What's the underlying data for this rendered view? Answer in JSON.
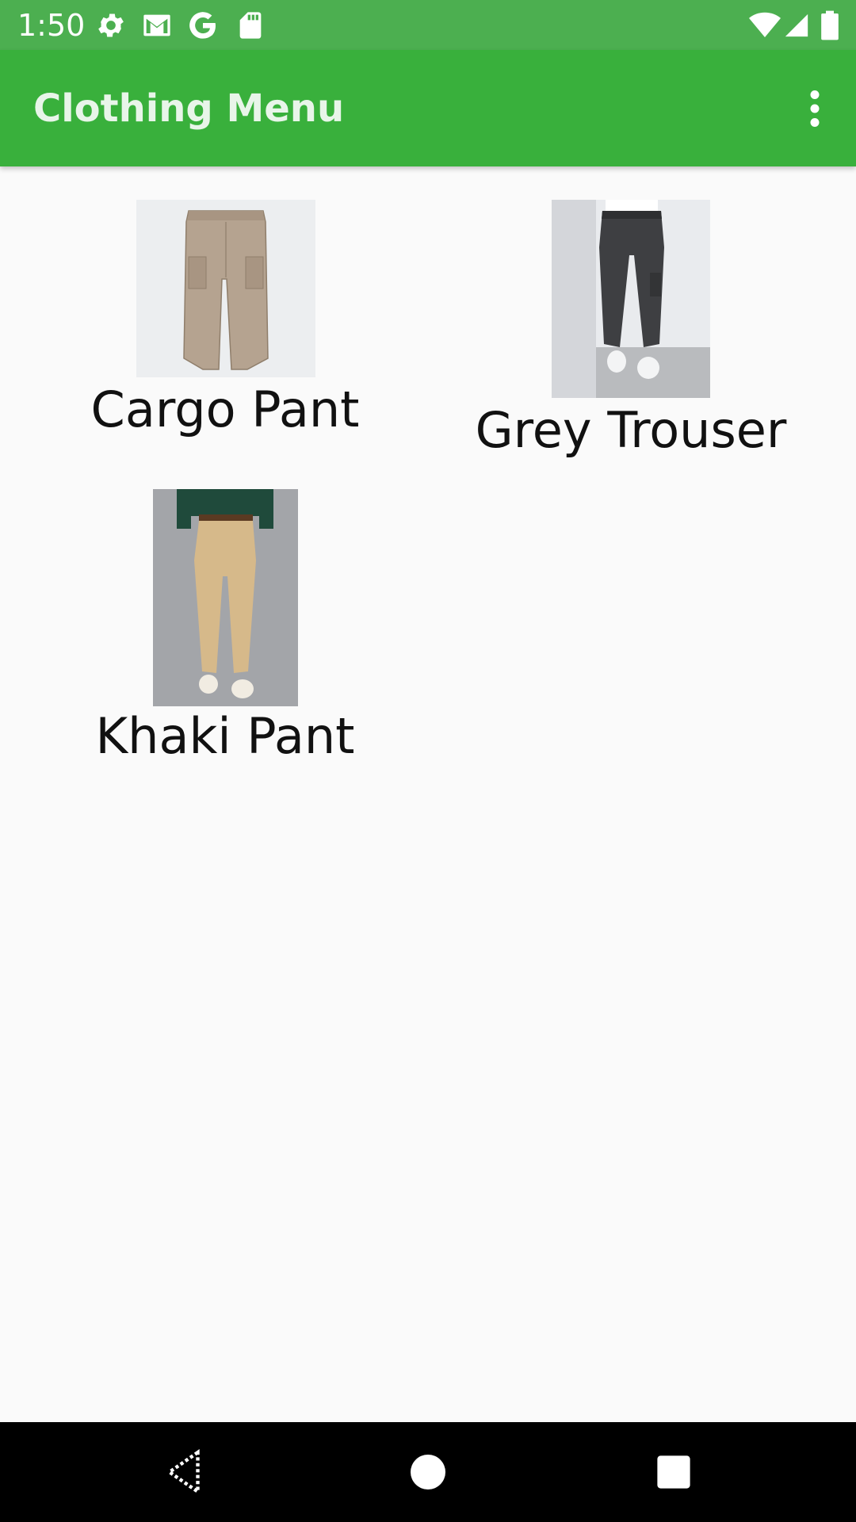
{
  "status_bar": {
    "time": "1:50",
    "left_icons": [
      "settings-icon",
      "gmail-icon",
      "google-icon",
      "sd-card-icon"
    ],
    "right_icons": [
      "wifi-icon",
      "signal-icon",
      "battery-icon"
    ]
  },
  "app_bar": {
    "title": "Clothing Menu",
    "menu_icon": "more-vert-icon"
  },
  "items": [
    {
      "label": "Cargo Pant",
      "image": "cargo-pant-image"
    },
    {
      "label": "Grey Trouser",
      "image": "grey-trouser-image"
    },
    {
      "label": "Khaki Pant",
      "image": "khaki-pant-image"
    }
  ],
  "nav_bar": {
    "buttons": [
      "back-icon",
      "home-icon",
      "recents-icon"
    ]
  },
  "colors": {
    "status_bar": "#4caf50",
    "app_bar": "#39b03c",
    "title_text": "#e8f5e9",
    "background": "#fafafa",
    "nav_bar": "#000000"
  }
}
